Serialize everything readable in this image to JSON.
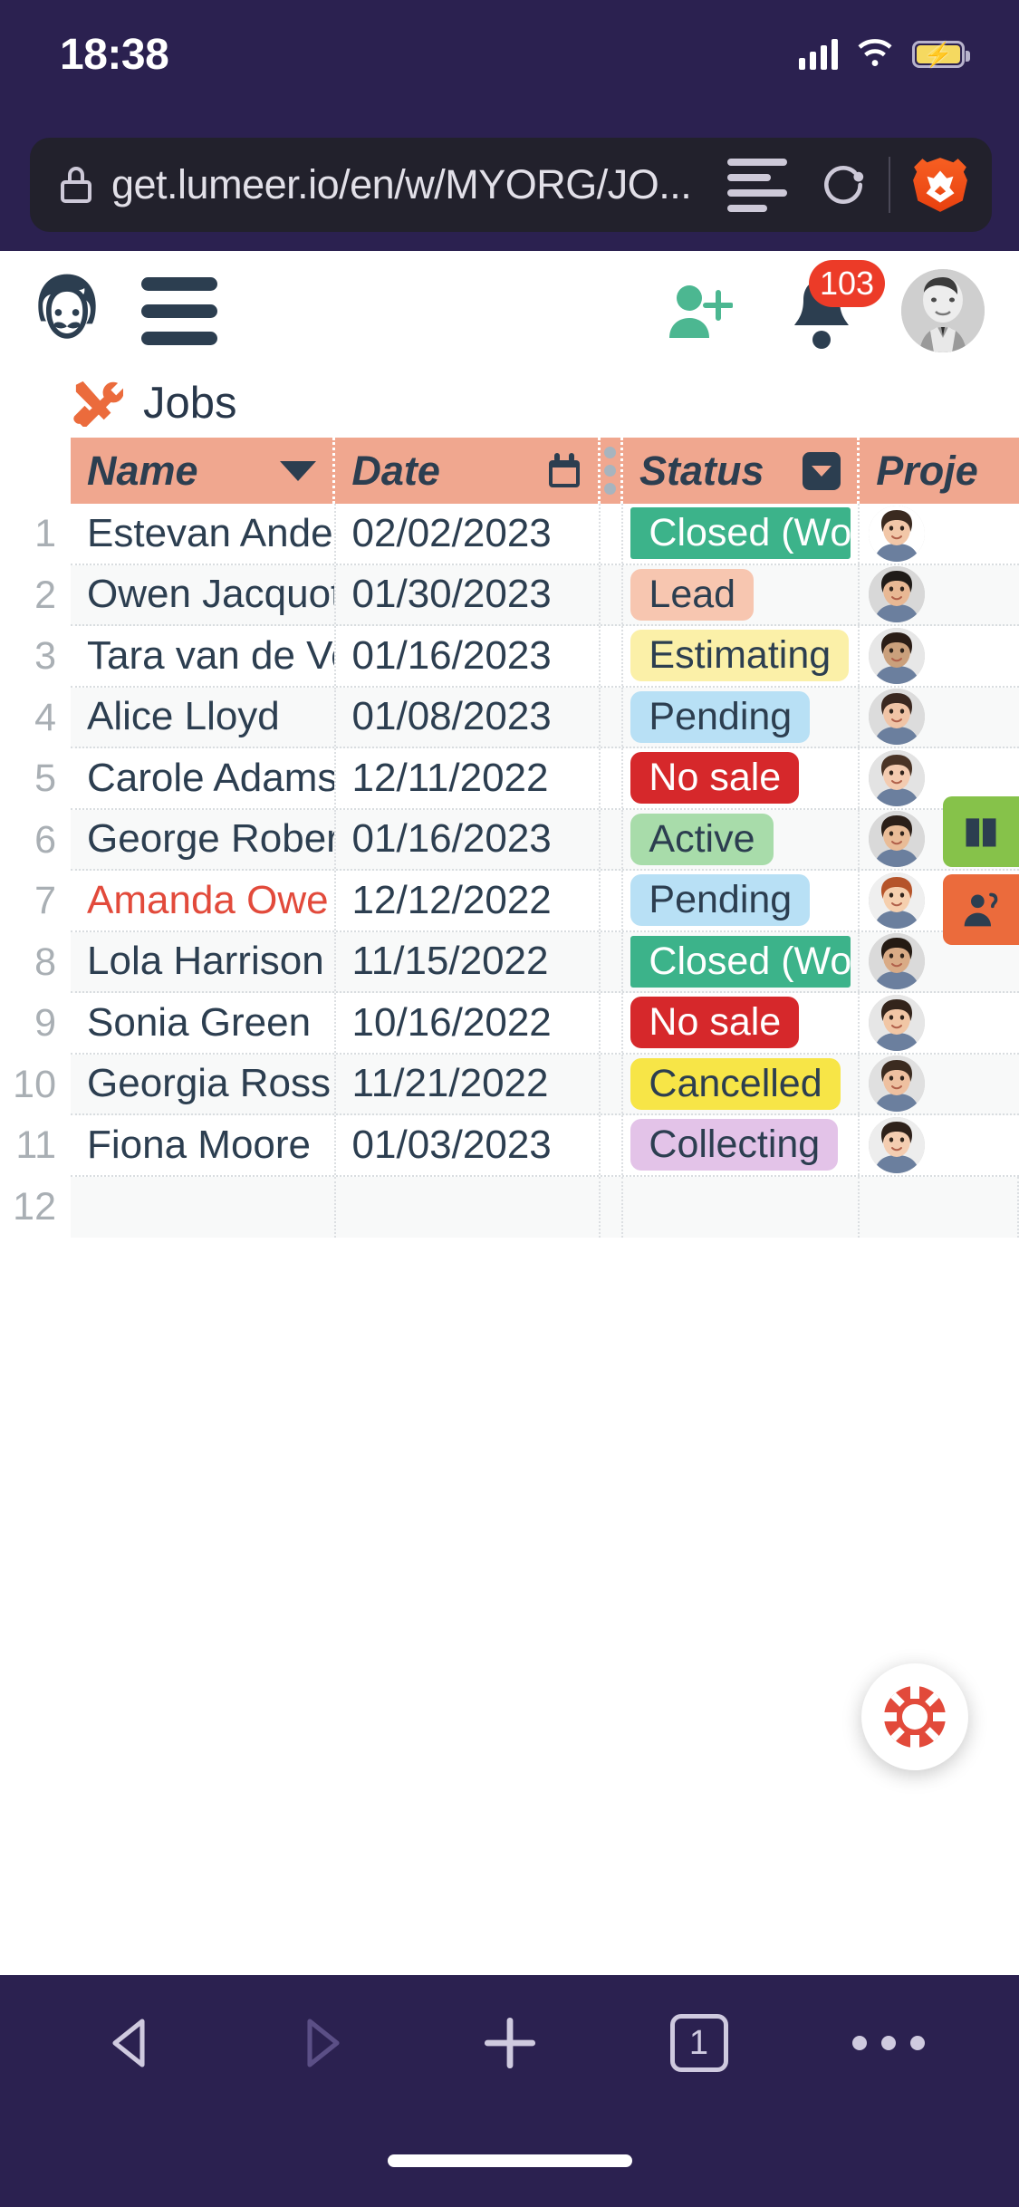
{
  "status_bar": {
    "time": "18:38",
    "battery_icon": "battery-charging-icon",
    "wifi_icon": "wifi-icon",
    "signal_icon": "cellular-signal-icon"
  },
  "browser": {
    "url": "get.lumeer.io/en/w/MYORG/JO...",
    "lock_icon": "lock-icon",
    "reader_icon": "reader-mode-icon",
    "reload_icon": "reload-icon",
    "brave_icon": "brave-lion-icon"
  },
  "app_header": {
    "logo_icon": "lumeer-logo-icon",
    "menu_icon": "hamburger-menu-icon",
    "invite_icon": "add-user-icon",
    "notifications_icon": "bell-icon",
    "notifications_count": "103",
    "avatar_icon": "user-avatar"
  },
  "table_title": {
    "icon": "tools-icon",
    "label": "Jobs"
  },
  "columns": [
    {
      "label": "Name",
      "icon": "chevron-down-icon"
    },
    {
      "label": "Date",
      "icon": "calendar-icon"
    },
    {
      "label": "Status",
      "icon": "select-dropdown-icon"
    },
    {
      "label": "Proje",
      "icon": ""
    }
  ],
  "rows": [
    {
      "num": "1",
      "name": "Estevan Ande",
      "name_alert": false,
      "date": "02/02/2023",
      "status": "Closed (Won)",
      "status_bg": "#3cb38a",
      "status_fg": "#ffffff",
      "status_square": true,
      "avatar": "avatar-photo"
    },
    {
      "num": "2",
      "name": "Owen Jacquot",
      "name_alert": false,
      "date": "01/30/2023",
      "status": "Lead",
      "status_bg": "#f7c6b0",
      "status_fg": "#2c3e50",
      "status_square": false,
      "avatar": "avatar-photo"
    },
    {
      "num": "3",
      "name": "Tara van de Ve",
      "name_alert": false,
      "date": "01/16/2023",
      "status": "Estimating",
      "status_bg": "#fbf0a8",
      "status_fg": "#2c3e50",
      "status_square": false,
      "avatar": "avatar-photo"
    },
    {
      "num": "4",
      "name": "Alice Lloyd",
      "name_alert": false,
      "date": "01/08/2023",
      "status": "Pending",
      "status_bg": "#b8e0f5",
      "status_fg": "#2c3e50",
      "status_square": false,
      "avatar": "avatar-photo"
    },
    {
      "num": "5",
      "name": "Carole Adams",
      "name_alert": false,
      "date": "12/11/2022",
      "status": "No sale",
      "status_bg": "#d6282b",
      "status_fg": "#ffffff",
      "status_square": false,
      "avatar": "avatar-photo"
    },
    {
      "num": "6",
      "name": "George Rober",
      "name_alert": false,
      "date": "01/16/2023",
      "status": "Active",
      "status_bg": "#a8dcaa",
      "status_fg": "#2c3e50",
      "status_square": false,
      "avatar": "avatar-photo"
    },
    {
      "num": "7",
      "name": "Amanda Owe",
      "name_alert": true,
      "date": "12/12/2022",
      "status": "Pending",
      "status_bg": "#b8e0f5",
      "status_fg": "#2c3e50",
      "status_square": false,
      "avatar": "avatar-photo"
    },
    {
      "num": "8",
      "name": "Lola Harrison",
      "name_alert": false,
      "date": "11/15/2022",
      "status": "Closed (Won)",
      "status_bg": "#3cb38a",
      "status_fg": "#ffffff",
      "status_square": true,
      "avatar": "avatar-photo"
    },
    {
      "num": "9",
      "name": "Sonia Green",
      "name_alert": false,
      "date": "10/16/2022",
      "status": "No sale",
      "status_bg": "#d6282b",
      "status_fg": "#ffffff",
      "status_square": false,
      "avatar": "avatar-photo"
    },
    {
      "num": "10",
      "name": "Georgia Ross",
      "name_alert": false,
      "date": "11/21/2022",
      "status": "Cancelled",
      "status_bg": "#f7e547",
      "status_fg": "#2c3e50",
      "status_square": false,
      "avatar": "avatar-photo"
    },
    {
      "num": "11",
      "name": "Fiona Moore",
      "name_alert": false,
      "date": "01/03/2023",
      "status": "Collecting",
      "status_bg": "#e3c3e8",
      "status_fg": "#2c3e50",
      "status_square": false,
      "avatar": "avatar-photo"
    },
    {
      "num": "12",
      "name": "",
      "name_alert": false,
      "date": "",
      "status": "",
      "status_bg": "transparent",
      "status_fg": "#2c3e50",
      "status_square": false,
      "avatar": ""
    }
  ],
  "side_buttons": [
    {
      "icon": "book-icon",
      "color": "#86c24a"
    },
    {
      "icon": "person-icon",
      "color": "#eb6b3c"
    }
  ],
  "help_button": {
    "icon": "lifebuoy-icon",
    "color": "#e24a3b"
  },
  "bottom_nav": {
    "back_icon": "back-triangle-icon",
    "forward_icon": "forward-triangle-icon",
    "new_tab_icon": "plus-icon",
    "tabs_count": "1",
    "more_icon": "more-dots-icon"
  },
  "colors": {
    "chrome_purple": "#2b2150",
    "urlbar_dark": "#22212c",
    "header_salmon": "#f0a78f",
    "brand_navy": "#2c3e50",
    "accent_green": "#3cb38a",
    "badge_red": "#ec3b28"
  }
}
